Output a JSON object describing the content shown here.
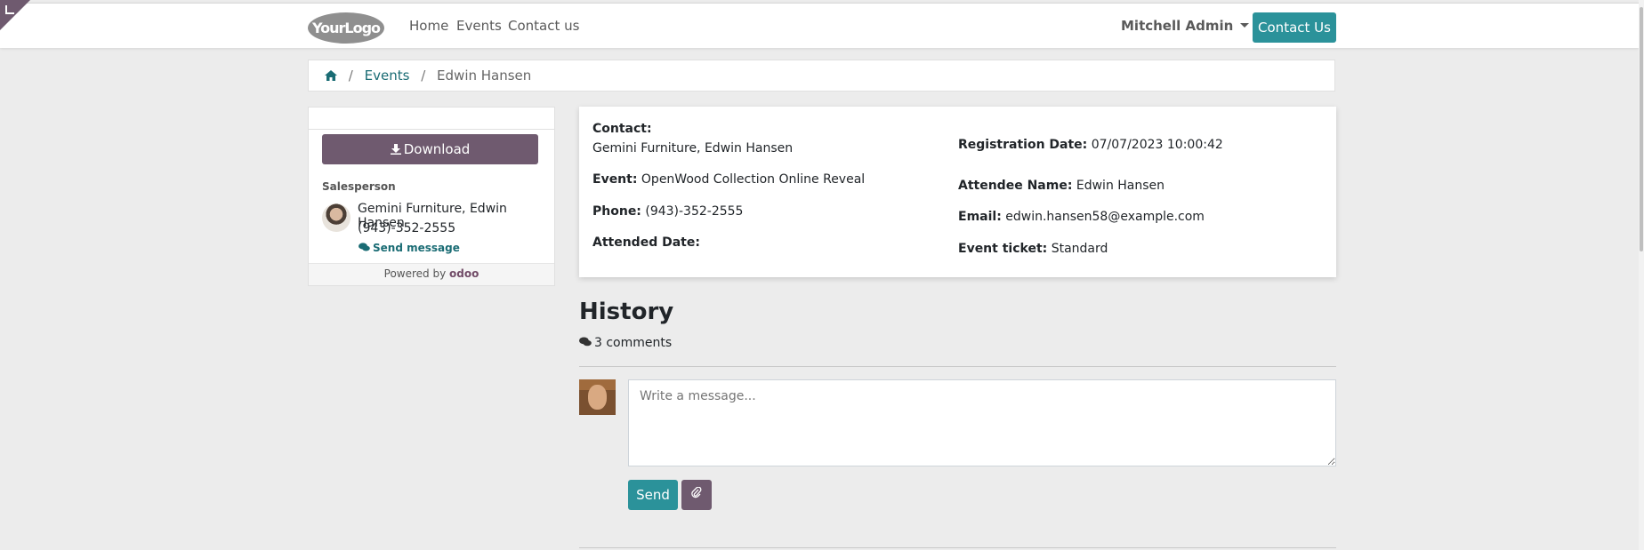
{
  "header": {
    "logo": "YourLogo",
    "nav": [
      "Home",
      "Events",
      "Contact us"
    ],
    "user": "Mitchell Admin",
    "contact_button": "Contact Us"
  },
  "breadcrumb": {
    "home_icon": "home-icon",
    "events": "Events",
    "current": "Edwin Hansen"
  },
  "sidebar": {
    "download_label": "Download",
    "salesperson_label": "Salesperson",
    "salesperson_name": "Gemini Furniture, Edwin Hansen",
    "salesperson_phone": "(943)-352-2555",
    "send_message": "Send message",
    "powered_by": "Powered by",
    "brand": "odoo"
  },
  "details": {
    "contact_label": "Contact:",
    "contact_value": "Gemini Furniture, Edwin Hansen",
    "event_label": "Event:",
    "event_value": "OpenWood Collection Online Reveal",
    "phone_label": "Phone:",
    "phone_value": "(943)-352-2555",
    "attended_label": "Attended Date:",
    "registration_label": "Registration Date:",
    "registration_value": "07/07/2023 10:00:42",
    "attendee_label": "Attendee Name:",
    "attendee_value": "Edwin Hansen",
    "email_label": "Email:",
    "email_value": "edwin.hansen58@example.com",
    "ticket_label": "Event ticket:",
    "ticket_value": "Standard"
  },
  "history": {
    "title": "History",
    "comments": "3 comments",
    "placeholder": "Write a message...",
    "send_label": "Send"
  },
  "colors": {
    "primary": "#2b929a",
    "secondary": "#6f5a6f",
    "link": "#1a6c74"
  }
}
